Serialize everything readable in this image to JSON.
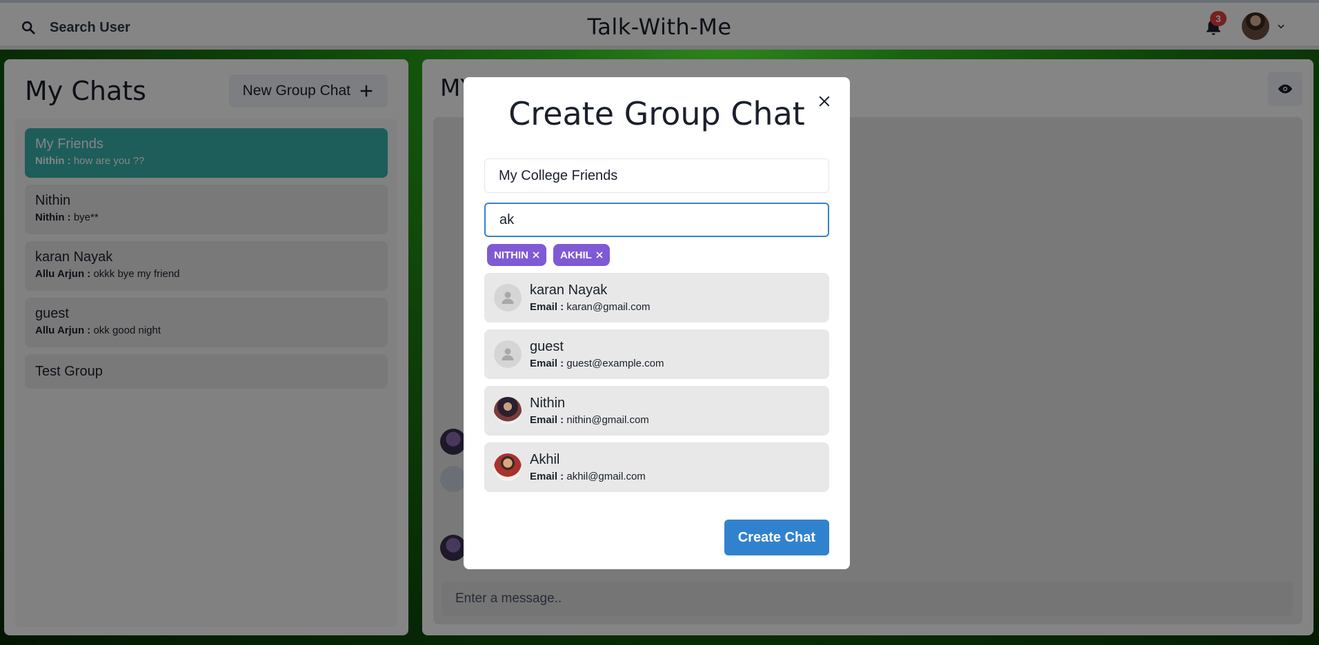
{
  "header": {
    "search_label": "Search User",
    "app_title": "Talk-With-Me",
    "notification_count": "3"
  },
  "sidebar": {
    "title": "My Chats",
    "new_group_label": "New Group Chat",
    "chats": [
      {
        "name": "My Friends",
        "sender": "Nithin :",
        "message": "how are you ??",
        "active": true
      },
      {
        "name": "Nithin",
        "sender": "Nithin :",
        "message": "bye**",
        "active": false
      },
      {
        "name": "karan Nayak",
        "sender": "Allu Arjun :",
        "message": "okkk bye my friend",
        "active": false
      },
      {
        "name": "guest",
        "sender": "Allu Arjun :",
        "message": "okk good night",
        "active": false
      },
      {
        "name": "Test Group",
        "sender": "",
        "message": "",
        "active": false
      }
    ]
  },
  "main": {
    "title": "MY",
    "message_placeholder": "Enter a message.."
  },
  "modal": {
    "title": "Create Group Chat",
    "chat_name_value": "My College Friends",
    "search_value": "ak",
    "selected_users": [
      "NITHIN",
      "AKHIL"
    ],
    "email_label": "Email :",
    "results": [
      {
        "name": "karan Nayak",
        "email": "karan@gmail.com",
        "avatar": "default-user-icon"
      },
      {
        "name": "guest",
        "email": "guest@example.com",
        "avatar": "default-user-icon"
      },
      {
        "name": "Nithin",
        "email": "nithin@gmail.com",
        "avatar": "photo"
      },
      {
        "name": "Akhil",
        "email": "akhil@gmail.com",
        "avatar": "photo"
      }
    ],
    "create_label": "Create Chat"
  },
  "colors": {
    "accent_teal": "#38b2ac",
    "tag_purple": "#805ad5",
    "button_blue": "#3182ce",
    "badge_red": "#e53e3e"
  }
}
